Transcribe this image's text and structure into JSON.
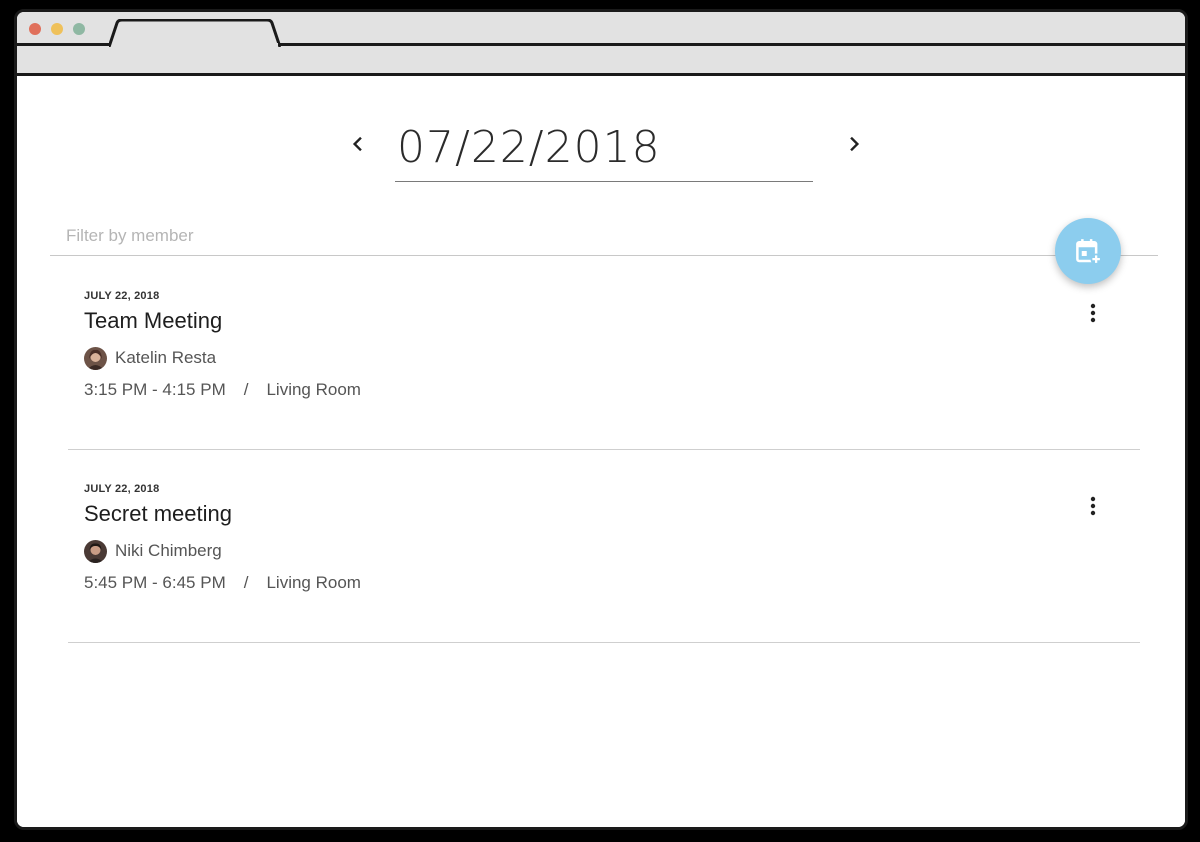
{
  "window": {
    "controls": [
      {
        "name": "close",
        "color": "#e0705b"
      },
      {
        "name": "minimize",
        "color": "#efc15a"
      },
      {
        "name": "zoom",
        "color": "#8fb8a3"
      }
    ]
  },
  "date_nav": {
    "prev_icon": "chevron-left-icon",
    "next_icon": "chevron-right-icon",
    "date": "07/22/2018"
  },
  "filter": {
    "placeholder": "Filter by member",
    "value": ""
  },
  "fab": {
    "icon": "calendar-add-icon",
    "color": "#8ccdee"
  },
  "events": [
    {
      "date_label": "JULY 22, 2018",
      "title": "Team Meeting",
      "member": "Katelin Resta",
      "time": "3:15 PM - 4:15 PM",
      "separator": "/",
      "location": "Living Room",
      "menu_icon": "more-vert-icon"
    },
    {
      "date_label": "JULY 22, 2018",
      "title": "Secret meeting",
      "member": "Niki Chimberg",
      "time": "5:45 PM - 6:45 PM",
      "separator": "/",
      "location": "Living Room",
      "menu_icon": "more-vert-icon"
    }
  ]
}
